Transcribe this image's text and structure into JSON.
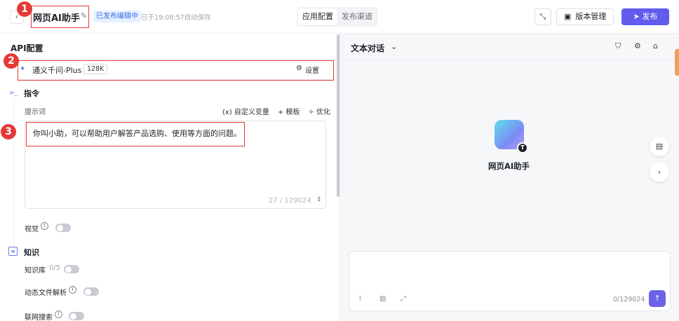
{
  "header": {
    "back_icon": "chevron-left-icon",
    "title": "网页AI助手",
    "status_badge": "已发布编辑中",
    "autosave": "已于19:08:57自动保存",
    "tabs": [
      "应用配置",
      "发布渠道"
    ],
    "version_label": "版本管理",
    "publish_label": "发布",
    "accent": "#615ced"
  },
  "config": {
    "section_title": "API配置",
    "model": {
      "name": "通义千问-Plus",
      "context": "128K",
      "settings_label": "设置"
    },
    "instruction": {
      "title": "指令",
      "prompt_label": "提示词",
      "tools": [
        "自定义变量",
        "模板",
        "优化"
      ],
      "prompt_text": "你叫小助，可以帮助用户解答产品选购、使用等方面的问题。",
      "prompt_count": "27 / 129024"
    },
    "vision": {
      "label": "视觉",
      "enabled": false
    },
    "knowledge": {
      "title": "知识",
      "kb_label": "知识库",
      "kb_count": "0/5",
      "file_parse_label": "动态文件解析",
      "web_search_label": "联网搜索"
    }
  },
  "chat": {
    "mode": "文本对话",
    "bot_name": "网页AI助手",
    "avatar_badge": "T",
    "input_count": "0/129024"
  },
  "annotations": [
    "1",
    "2",
    "3"
  ]
}
